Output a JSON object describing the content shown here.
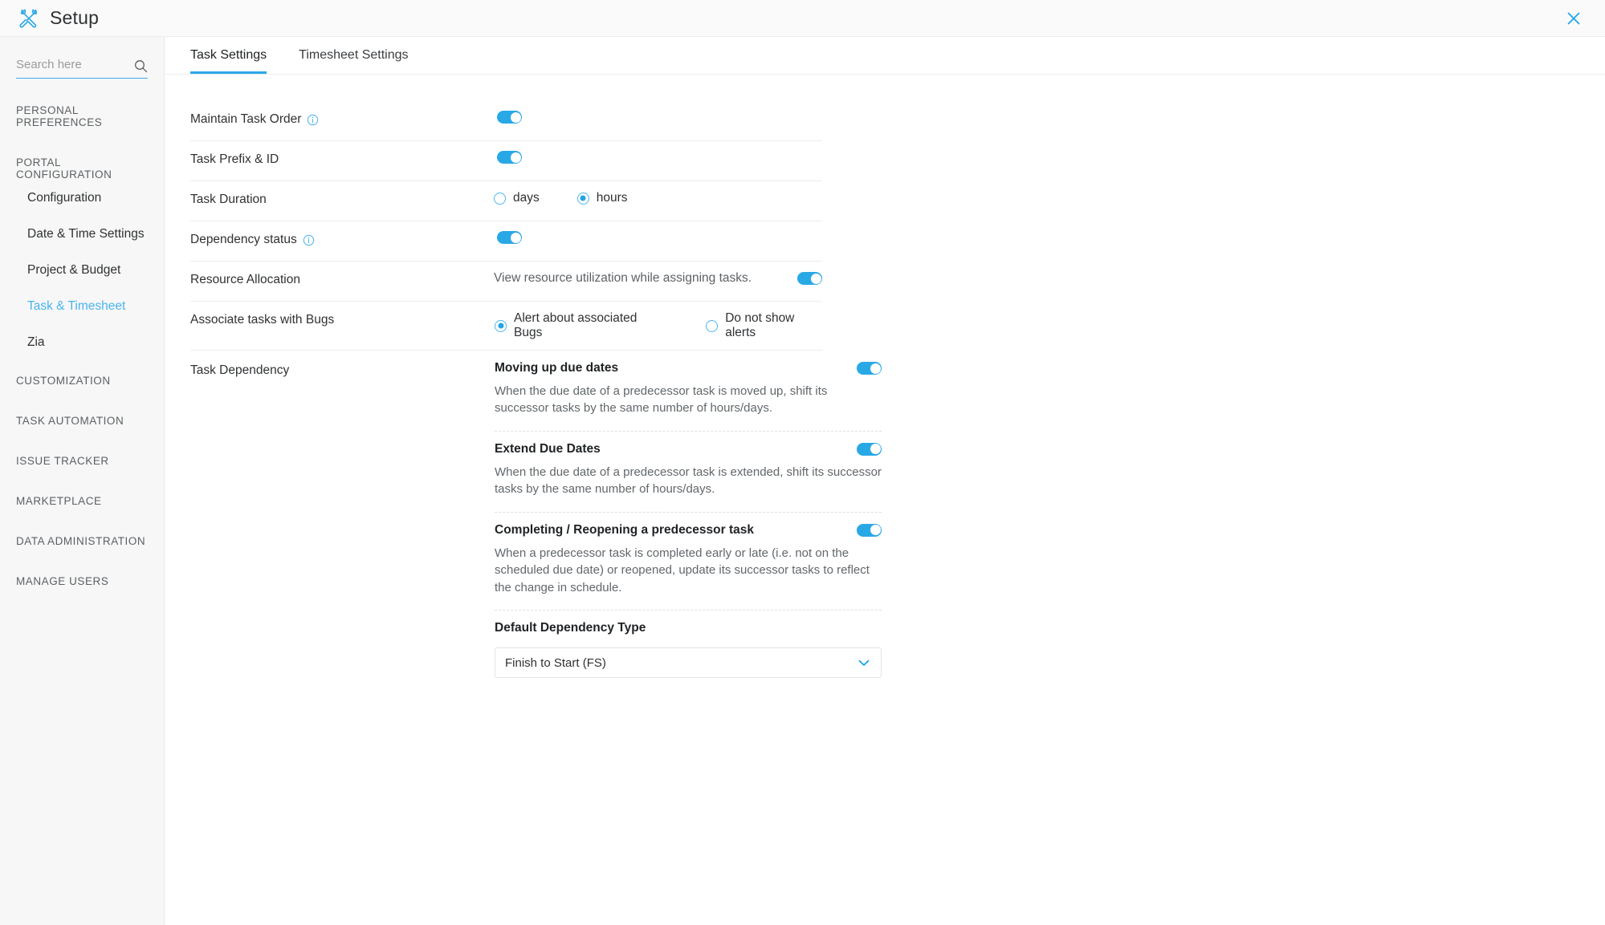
{
  "window": {
    "title": "Setup",
    "tools_icon": "tools-icon",
    "close_icon": "close-icon"
  },
  "sidebar": {
    "search": {
      "placeholder": "Search here",
      "value": "",
      "icon": "search-icon"
    },
    "groups": [
      {
        "label": "PERSONAL PREFERENCES",
        "items": []
      },
      {
        "label": "PORTAL CONFIGURATION",
        "items": [
          {
            "label": "Configuration",
            "active": false
          },
          {
            "label": "Date & Time Settings",
            "active": false
          },
          {
            "label": "Project & Budget",
            "active": false
          },
          {
            "label": "Task & Timesheet",
            "active": true
          },
          {
            "label": "Zia",
            "active": false
          }
        ]
      },
      {
        "label": "CUSTOMIZATION",
        "items": []
      },
      {
        "label": "TASK AUTOMATION",
        "items": []
      },
      {
        "label": "ISSUE TRACKER",
        "items": []
      },
      {
        "label": "MARKETPLACE",
        "items": []
      },
      {
        "label": "DATA ADMINISTRATION",
        "items": []
      },
      {
        "label": "MANAGE USERS",
        "items": []
      }
    ]
  },
  "main": {
    "tabs": [
      {
        "label": "Task Settings",
        "active": true
      },
      {
        "label": "Timesheet Settings",
        "active": false
      }
    ],
    "rows": {
      "maintain_task_order": {
        "label": "Maintain Task Order",
        "has_info": true,
        "toggle_on": true
      },
      "task_prefix_id": {
        "label": "Task Prefix & ID",
        "has_info": false,
        "toggle_on": true
      },
      "task_duration": {
        "label": "Task Duration",
        "options": [
          {
            "label": "days",
            "selected": false
          },
          {
            "label": "hours",
            "selected": true
          }
        ]
      },
      "dependency_status": {
        "label": "Dependency status",
        "has_info": true,
        "toggle_on": true
      },
      "resource_allocation": {
        "label": "Resource Allocation",
        "description": "View resource utilization while assigning tasks.",
        "toggle_on": true
      },
      "associate_tasks_with_bugs": {
        "label": "Associate tasks with Bugs",
        "options": [
          {
            "label": "Alert about associated Bugs",
            "selected": true
          },
          {
            "label": "Do not show alerts",
            "selected": false
          }
        ]
      },
      "task_dependency": {
        "label": "Task Dependency",
        "blocks": [
          {
            "title": "Moving up due dates",
            "description": "When the due date of a predecessor task is moved up, shift its successor tasks by the same number of hours/days.",
            "toggle_on": true
          },
          {
            "title": "Extend Due Dates",
            "description": "When the due date of a predecessor task is extended, shift its successor tasks by the same number of hours/days.",
            "toggle_on": true
          },
          {
            "title": "Completing / Reopening a predecessor task",
            "description": "When a predecessor task is completed early or late (i.e. not on the scheduled due date) or reopened, update its successor tasks to reflect the change in schedule.",
            "toggle_on": true
          }
        ],
        "default_dependency_type": {
          "label": "Default Dependency Type",
          "value": "Finish to Start (FS)",
          "chevron_icon": "chevron-down-icon"
        }
      }
    }
  },
  "colors": {
    "accent": "#29a8e6",
    "active_text": "#4ab4ee",
    "tab_underline": "#2ba7e8"
  }
}
